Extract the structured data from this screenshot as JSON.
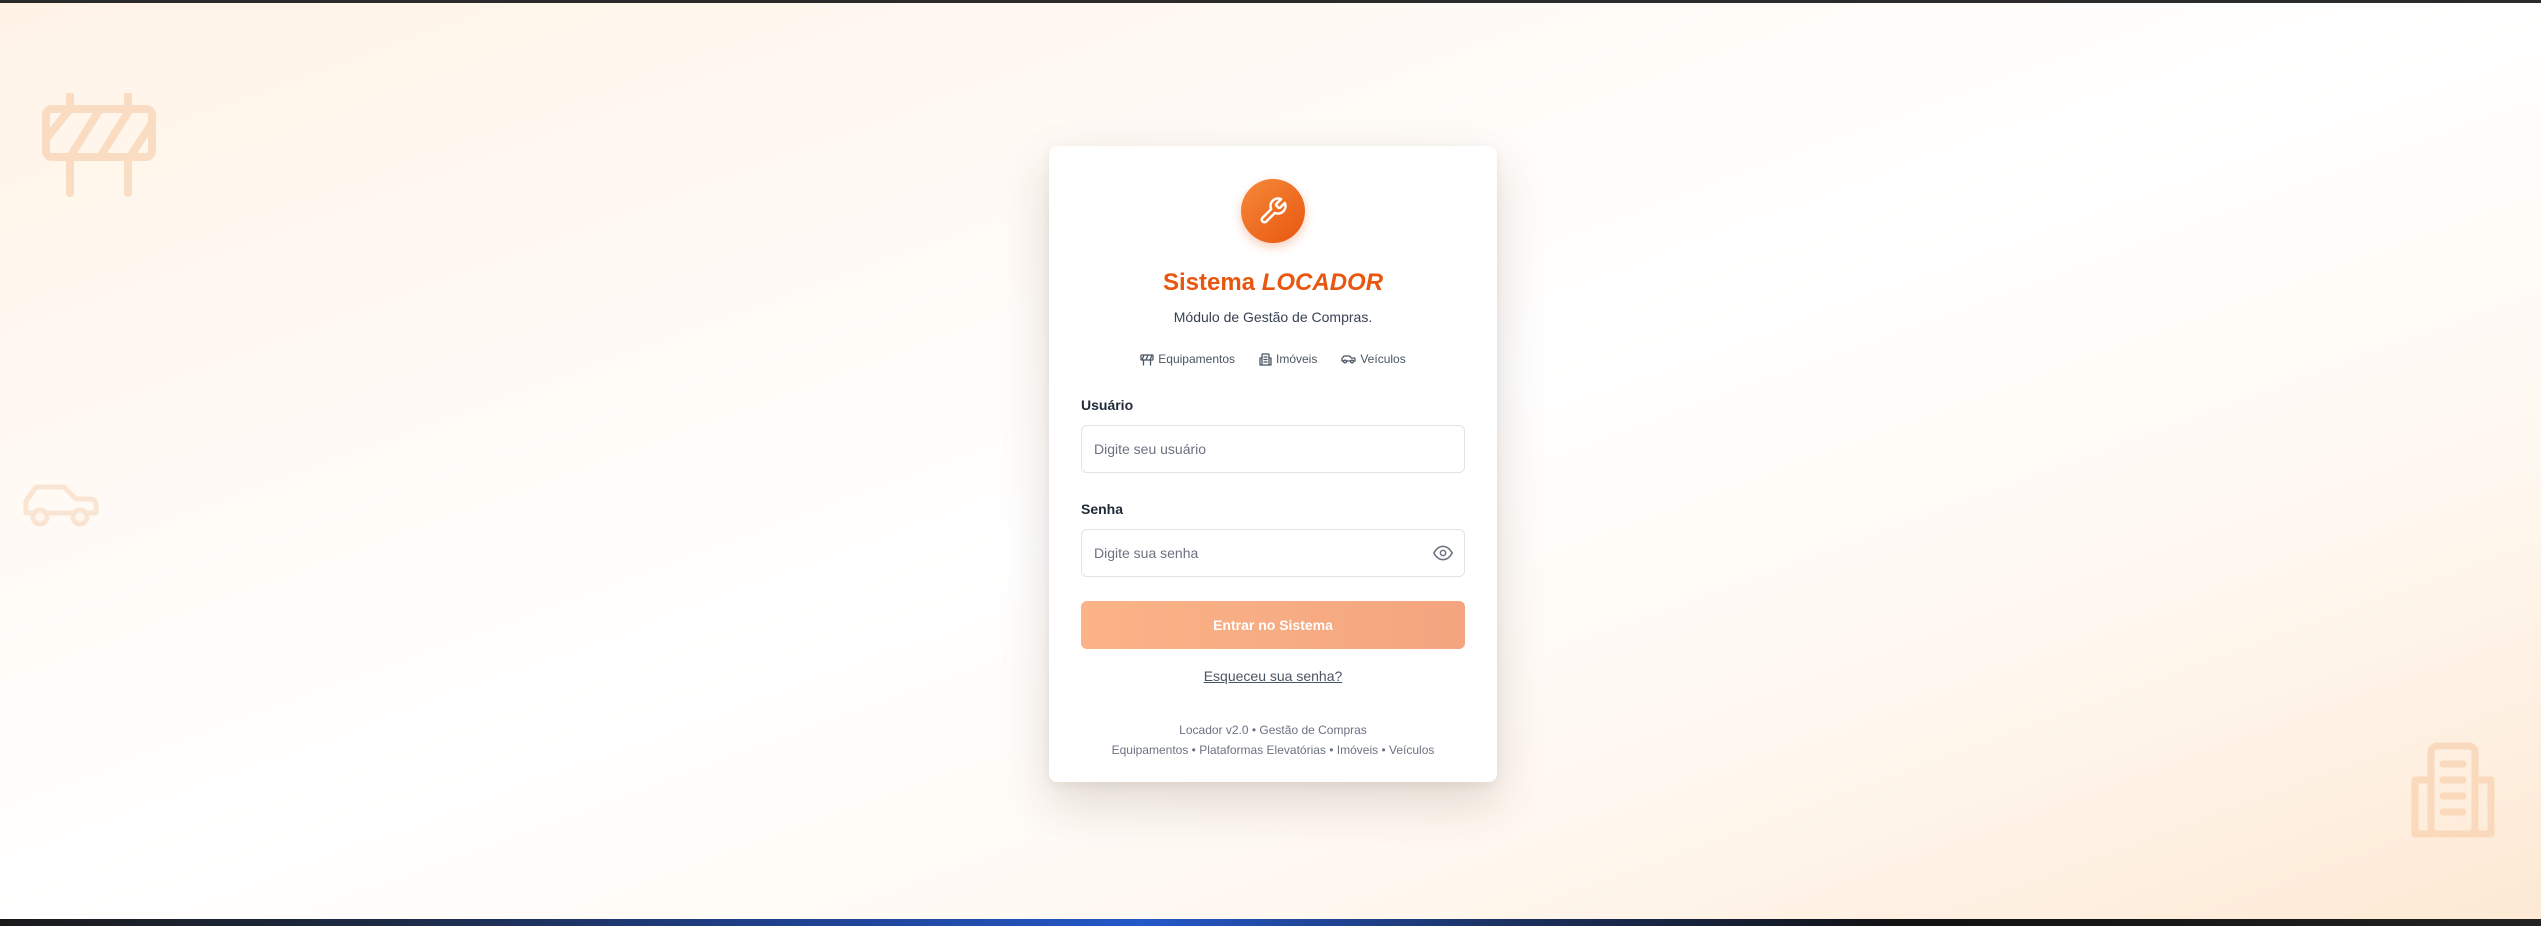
{
  "brand": {
    "name": "Sistema",
    "name_emphasis": "LOCADOR",
    "subtitle": "Módulo de Gestão de Compras."
  },
  "logo": {
    "icon": "wrench-icon",
    "color": "#e8560f"
  },
  "categories": [
    {
      "label": "Equipamentos",
      "icon": "barrier-icon"
    },
    {
      "label": "Imóveis",
      "icon": "building-icon"
    },
    {
      "label": "Veículos",
      "icon": "car-icon"
    }
  ],
  "form": {
    "user_label": "Usuário",
    "user_placeholder": "Digite seu usuário",
    "user_value": "",
    "password_label": "Senha",
    "password_placeholder": "Digite sua senha",
    "password_value": "",
    "submit_label": "Entrar no Sistema",
    "forgot_label": "Esqueceu sua senha?"
  },
  "footer": {
    "line1": "Locador v2.0 • Gestão de Compras",
    "line2": "Equipamentos • Plataformas Elevatórias • Imóveis • Veículos"
  },
  "colors": {
    "accent": "#e8560f",
    "button": "#f9ad85",
    "background": "#fff6ec"
  }
}
